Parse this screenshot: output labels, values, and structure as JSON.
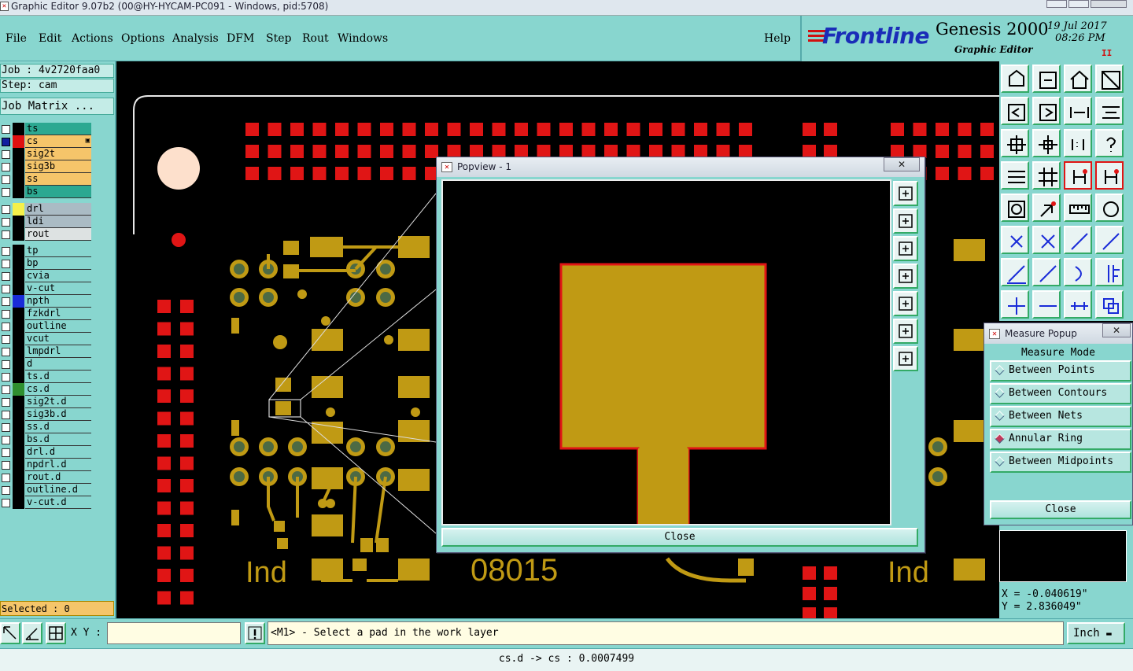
{
  "window": {
    "title": "Graphic Editor 9.07b2 (00@HY-HYCAM-PC091 - Windows, pid:5708)"
  },
  "menu": [
    "File",
    "Edit",
    "Actions",
    "Options",
    "Analysis",
    "DFM",
    "Step",
    "Rout",
    "Windows"
  ],
  "help": "Help",
  "logo": {
    "brand": "Frontline",
    "product": "Genesis 2000",
    "sub": "Graphic Editor",
    "date": "19  Jul  2017",
    "time": "08:26  PM",
    "pause": "II"
  },
  "job": {
    "job_line": "Job : 4v2720faa0",
    "step_line": "Step: cam",
    "matrix_btn": "Job Matrix ..."
  },
  "layers": {
    "group1": [
      {
        "name": "ts",
        "bg": "#2ca891",
        "sw": "#000000",
        "checked": false
      },
      {
        "name": "cs",
        "bg": "#f5c56a",
        "sw": "#e01010",
        "checked": true,
        "mark": "▣"
      },
      {
        "name": "sig2t",
        "bg": "#f5c56a",
        "sw": "#000000",
        "checked": false
      },
      {
        "name": "sig3b",
        "bg": "#f5c56a",
        "sw": "#000000",
        "checked": false
      },
      {
        "name": "ss",
        "bg": "#f5c56a",
        "sw": "#000000",
        "checked": false
      },
      {
        "name": "bs",
        "bg": "#2ca891",
        "sw": "#000000",
        "checked": false
      }
    ],
    "group2": [
      {
        "name": "drl",
        "bg": "#aabbc4",
        "sw": "#f5f04a",
        "checked": false
      },
      {
        "name": "ldi",
        "bg": "#aabbc4",
        "sw": "#000000",
        "checked": false
      },
      {
        "name": "rout",
        "bg": "#dde2e2",
        "sw": "#000000",
        "checked": false
      }
    ],
    "group3": [
      {
        "name": "tp",
        "bg": "#88d6cf",
        "sw": "#000000",
        "checked": false
      },
      {
        "name": "bp",
        "bg": "#88d6cf",
        "sw": "#000000",
        "checked": false
      },
      {
        "name": "cvia",
        "bg": "#88d6cf",
        "sw": "#000000",
        "checked": false
      },
      {
        "name": "v-cut",
        "bg": "#88d6cf",
        "sw": "#000000",
        "checked": false
      },
      {
        "name": "npth",
        "bg": "#88d6cf",
        "sw": "#1a2cd8",
        "checked": false
      },
      {
        "name": "fzkdrl",
        "bg": "#88d6cf",
        "sw": "#000000",
        "checked": false
      },
      {
        "name": "outline",
        "bg": "#88d6cf",
        "sw": "#000000",
        "checked": false
      },
      {
        "name": "vcut",
        "bg": "#88d6cf",
        "sw": "#000000",
        "checked": false
      },
      {
        "name": "lmpdrl",
        "bg": "#88d6cf",
        "sw": "#000000",
        "checked": false
      },
      {
        "name": "d",
        "bg": "#88d6cf",
        "sw": "#000000",
        "checked": false
      },
      {
        "name": "ts.d",
        "bg": "#88d6cf",
        "sw": "#000000",
        "checked": false
      },
      {
        "name": "cs.d",
        "bg": "#88d6cf",
        "sw": "#2f8f2f",
        "checked": false
      },
      {
        "name": "sig2t.d",
        "bg": "#88d6cf",
        "sw": "#000000",
        "checked": false
      },
      {
        "name": "sig3b.d",
        "bg": "#88d6cf",
        "sw": "#000000",
        "checked": false
      },
      {
        "name": "ss.d",
        "bg": "#88d6cf",
        "sw": "#000000",
        "checked": false
      },
      {
        "name": "bs.d",
        "bg": "#88d6cf",
        "sw": "#000000",
        "checked": false
      },
      {
        "name": "drl.d",
        "bg": "#88d6cf",
        "sw": "#000000",
        "checked": false
      },
      {
        "name": "npdrl.d",
        "bg": "#88d6cf",
        "sw": "#000000",
        "checked": false
      },
      {
        "name": "rout.d",
        "bg": "#88d6cf",
        "sw": "#000000",
        "checked": false
      },
      {
        "name": "outline.d",
        "bg": "#88d6cf",
        "sw": "#000000",
        "checked": false
      },
      {
        "name": "v-cut.d",
        "bg": "#88d6cf",
        "sw": "#000000",
        "checked": false
      }
    ]
  },
  "selected": "Selected : 0",
  "canvas_text": {
    "left": "Ind",
    "center": "08015",
    "right": "Ind"
  },
  "popview": {
    "title": "Popview - 1",
    "close": "Close"
  },
  "measure": {
    "title": "Measure Popup",
    "mode_label": "Measure Mode",
    "options": [
      {
        "label": "Between Points",
        "on": false
      },
      {
        "label": "Between Contours",
        "on": false
      },
      {
        "label": "Between Nets",
        "on": false
      },
      {
        "label": "Annular Ring",
        "on": true
      },
      {
        "label": "Between Midpoints",
        "on": false
      }
    ],
    "close": "Close"
  },
  "coords": {
    "x": "X = -0.040619\"",
    "y": "Y = 2.836049\""
  },
  "bottom": {
    "xy_label": "X Y :",
    "prompt": "<M1> - Select a pad in the work layer",
    "unit": "Inch"
  },
  "status": "cs.d -> cs : 0.0007499",
  "colors": {
    "copper": "#c09a14",
    "pad_red": "#e01515",
    "panel": "#88d6cf"
  }
}
